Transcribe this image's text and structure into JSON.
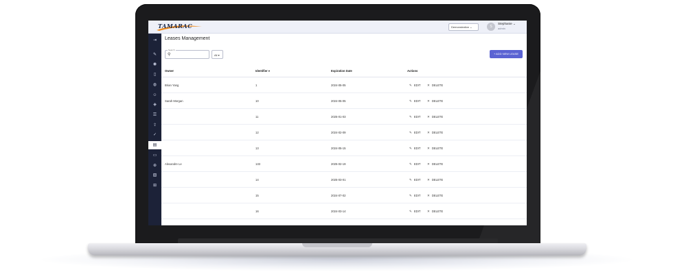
{
  "app": {
    "logo_text": "TAMARAC",
    "org_select": "Demonstration",
    "user_initial": "S",
    "user_name": "Stephanie",
    "user_role": "admin"
  },
  "sidebar": {
    "icons": [
      "menu-toggle-icon",
      "edit-icon",
      "location-icon",
      "tablet-icon",
      "globe-icon",
      "people-icon",
      "tag-icon",
      "list-icon",
      "upload-icon",
      "receipt-icon",
      "leases-icon",
      "folder-icon",
      "add-circle-icon",
      "document-search-icon",
      "add-box-icon"
    ],
    "active_index": 10
  },
  "page": {
    "title": "Leases Management",
    "search_label": "Search",
    "search_value": "",
    "filter_value": "All",
    "add_button": "+ ADD NEW LEASE"
  },
  "table": {
    "columns": [
      "Owner",
      "Identifier",
      "Expiration Date",
      "Actions"
    ],
    "sort_column": 1,
    "edit_label": "EDIT",
    "delete_label": "DELETE",
    "rows": [
      {
        "owner": "Brian Yang",
        "identifier": "1",
        "expiration": "2024-05-05"
      },
      {
        "owner": "Sarah Morgan",
        "identifier": "10",
        "expiration": "2024-05-05"
      },
      {
        "owner": "",
        "identifier": "11",
        "expiration": "2025-01-03"
      },
      {
        "owner": "",
        "identifier": "12",
        "expiration": "2024-02-09"
      },
      {
        "owner": "",
        "identifier": "13",
        "expiration": "2024-05-15"
      },
      {
        "owner": "Alexandre Le",
        "identifier": "133",
        "expiration": "2025-02-19"
      },
      {
        "owner": "",
        "identifier": "14",
        "expiration": "2025-03-01"
      },
      {
        "owner": "",
        "identifier": "15",
        "expiration": "2024-07-02"
      },
      {
        "owner": "",
        "identifier": "16",
        "expiration": "2024-03-14"
      },
      {
        "owner": "",
        "identifier": "17",
        "expiration": "2025-02-24"
      }
    ]
  },
  "colors": {
    "sidebar_bg": "#1c2238",
    "accent": "#5b63d3",
    "laptop_bezel": "#1b1b1d"
  }
}
